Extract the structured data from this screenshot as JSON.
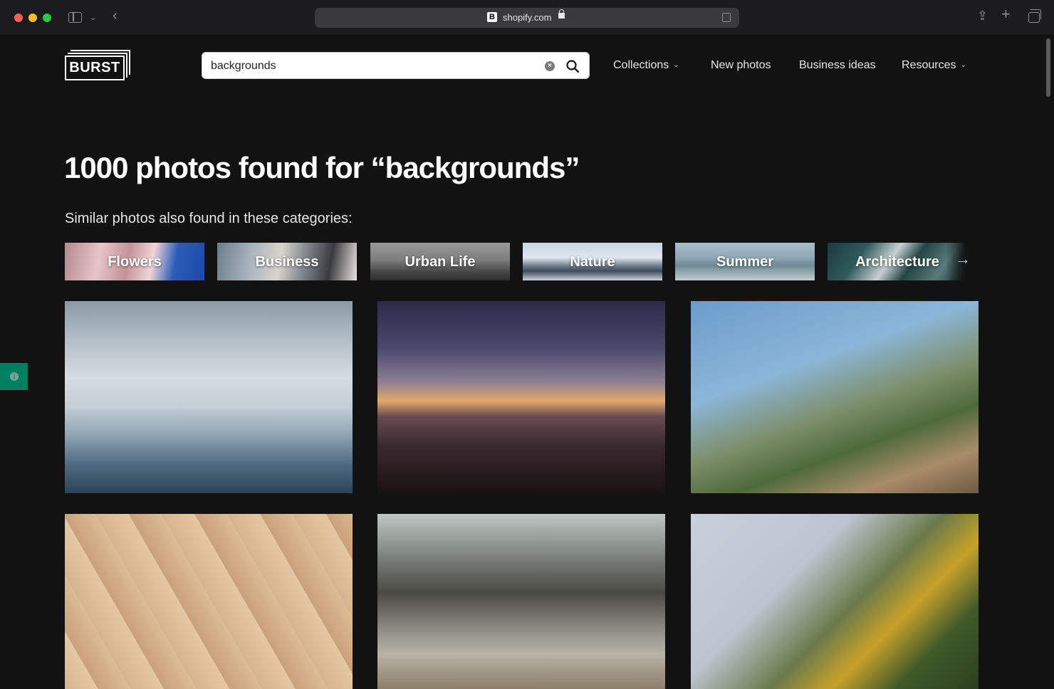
{
  "browser": {
    "url": "shopify.com",
    "favicon_letter": "B"
  },
  "header": {
    "logo_text": "BURST",
    "search": {
      "value": "backgrounds",
      "placeholder": ""
    },
    "nav": {
      "collections": "Collections",
      "new_photos": "New photos",
      "business_ideas": "Business ideas",
      "resources": "Resources"
    }
  },
  "main": {
    "title": "1000 photos found for “backgrounds”",
    "similar_label": "Similar photos also found in these categories:",
    "categories": [
      {
        "label": "Flowers"
      },
      {
        "label": "Business"
      },
      {
        "label": "Urban Life"
      },
      {
        "label": "Nature"
      },
      {
        "label": "Summer"
      },
      {
        "label": "Architecture"
      }
    ],
    "photos": [
      {
        "subject": "clouds"
      },
      {
        "subject": "sunset beach"
      },
      {
        "subject": "coastal path"
      },
      {
        "subject": "wood chevron"
      },
      {
        "subject": "patio cafe"
      },
      {
        "subject": "yellow flowers"
      }
    ]
  },
  "colors": {
    "background": "#121212",
    "feedback_tab": "#008060"
  }
}
